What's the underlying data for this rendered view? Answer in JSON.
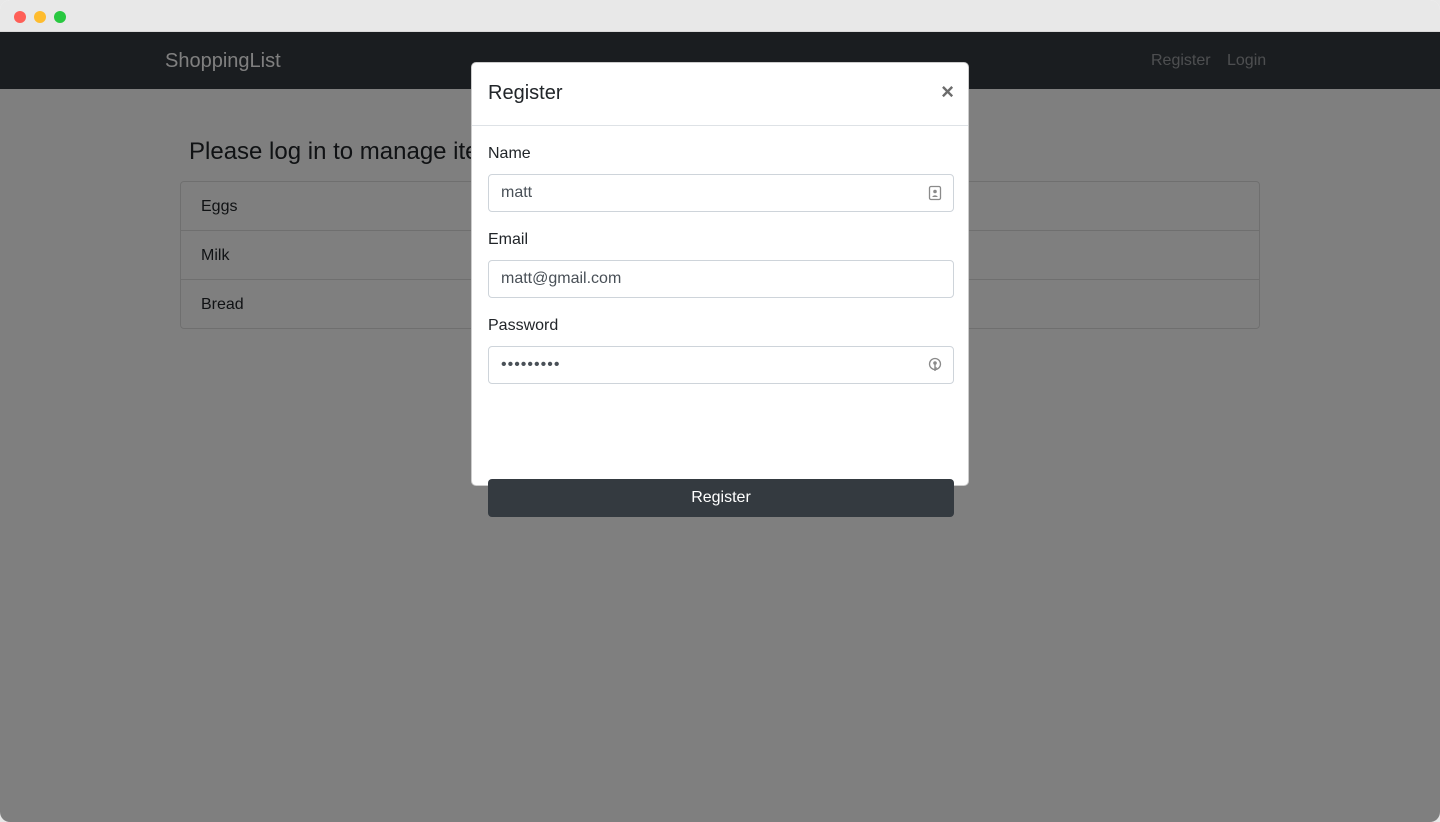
{
  "navbar": {
    "brand": "ShoppingList",
    "links": [
      "Register",
      "Login"
    ]
  },
  "main": {
    "heading": "Please log in to manage items",
    "items": [
      "Eggs",
      "Milk",
      "Bread"
    ]
  },
  "modal": {
    "title": "Register",
    "close_glyph": "×",
    "fields": {
      "name": {
        "label": "Name",
        "value": "matt",
        "icon": "contact-card-icon"
      },
      "email": {
        "label": "Email",
        "value": "matt@gmail.com"
      },
      "password": {
        "label": "Password",
        "value": "•••••••••",
        "icon": "key-icon"
      }
    },
    "submit_label": "Register"
  },
  "colors": {
    "navbar": "#343a40",
    "button": "#343a40",
    "backdrop": "rgba(0,0,0,0.5)"
  }
}
